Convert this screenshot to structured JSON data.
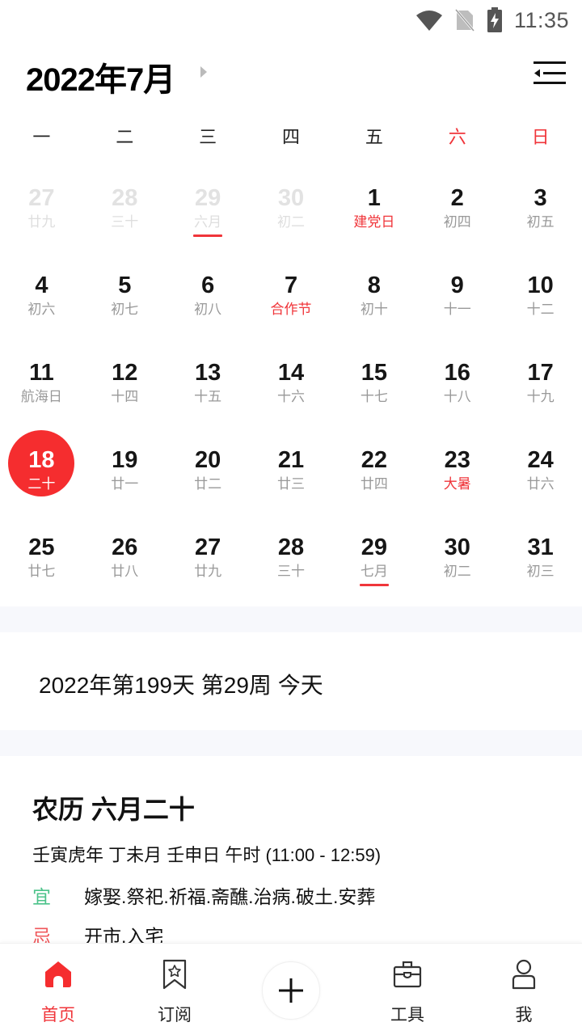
{
  "status_bar": {
    "time": "11:35",
    "icons": [
      "wifi-icon",
      "no-sim-icon",
      "battery-charging-icon"
    ]
  },
  "header": {
    "title": "2022年7月",
    "next_icon": "triangle-right-icon",
    "menu_icon": "menu-collapse-icon"
  },
  "weekdays": [
    {
      "label": "一",
      "weekend": false
    },
    {
      "label": "二",
      "weekend": false
    },
    {
      "label": "三",
      "weekend": false
    },
    {
      "label": "四",
      "weekend": false
    },
    {
      "label": "五",
      "weekend": false
    },
    {
      "label": "六",
      "weekend": true
    },
    {
      "label": "日",
      "weekend": true
    }
  ],
  "calendar": {
    "weeks": [
      [
        {
          "day": "27",
          "lunar": "廿九",
          "other": true
        },
        {
          "day": "28",
          "lunar": "三十",
          "other": true
        },
        {
          "day": "29",
          "lunar": "六月",
          "other": true,
          "month_start": true
        },
        {
          "day": "30",
          "lunar": "初二",
          "other": true
        },
        {
          "day": "1",
          "lunar": "建党日",
          "festival": true
        },
        {
          "day": "2",
          "lunar": "初四"
        },
        {
          "day": "3",
          "lunar": "初五"
        }
      ],
      [
        {
          "day": "4",
          "lunar": "初六"
        },
        {
          "day": "5",
          "lunar": "初七"
        },
        {
          "day": "6",
          "lunar": "初八"
        },
        {
          "day": "7",
          "lunar": "合作节",
          "festival": true
        },
        {
          "day": "8",
          "lunar": "初十"
        },
        {
          "day": "9",
          "lunar": "十一"
        },
        {
          "day": "10",
          "lunar": "十二"
        }
      ],
      [
        {
          "day": "11",
          "lunar": "航海日"
        },
        {
          "day": "12",
          "lunar": "十四"
        },
        {
          "day": "13",
          "lunar": "十五"
        },
        {
          "day": "14",
          "lunar": "十六"
        },
        {
          "day": "15",
          "lunar": "十七"
        },
        {
          "day": "16",
          "lunar": "十八"
        },
        {
          "day": "17",
          "lunar": "十九"
        }
      ],
      [
        {
          "day": "18",
          "lunar": "二十",
          "today": true
        },
        {
          "day": "19",
          "lunar": "廿一"
        },
        {
          "day": "20",
          "lunar": "廿二"
        },
        {
          "day": "21",
          "lunar": "廿三"
        },
        {
          "day": "22",
          "lunar": "廿四"
        },
        {
          "day": "23",
          "lunar": "大暑",
          "festival": true
        },
        {
          "day": "24",
          "lunar": "廿六"
        }
      ],
      [
        {
          "day": "25",
          "lunar": "廿七"
        },
        {
          "day": "26",
          "lunar": "廿八"
        },
        {
          "day": "27",
          "lunar": "廿九"
        },
        {
          "day": "28",
          "lunar": "三十"
        },
        {
          "day": "29",
          "lunar": "七月",
          "month_start": true
        },
        {
          "day": "30",
          "lunar": "初二"
        },
        {
          "day": "31",
          "lunar": "初三"
        }
      ]
    ]
  },
  "info": {
    "line": "2022年第199天 第29周 今天"
  },
  "lunar": {
    "title": "农历 六月二十",
    "ganzhi": "壬寅虎年 丁未月 壬申日 午时 (11:00 - 12:59)",
    "yi_label": "宜",
    "yi_items": "嫁娶.祭祀.祈福.斋醮.治病.破土.安葬",
    "ji_label": "忌",
    "ji_items": "开市.入宅"
  },
  "bottom_nav": {
    "items": [
      {
        "label": "首页",
        "icon": "home-icon",
        "active": true
      },
      {
        "label": "订阅",
        "icon": "bookmark-star-icon",
        "active": false
      },
      {
        "label": "工具",
        "icon": "toolbox-icon",
        "active": false
      },
      {
        "label": "我",
        "icon": "user-icon",
        "active": false
      }
    ],
    "add_icon": "plus-icon"
  },
  "colors": {
    "accent": "#f0353a",
    "today_bg": "#f52d2f",
    "yi": "#4cc38a",
    "ji": "#f0565a",
    "separator": "#f7f8fc"
  }
}
